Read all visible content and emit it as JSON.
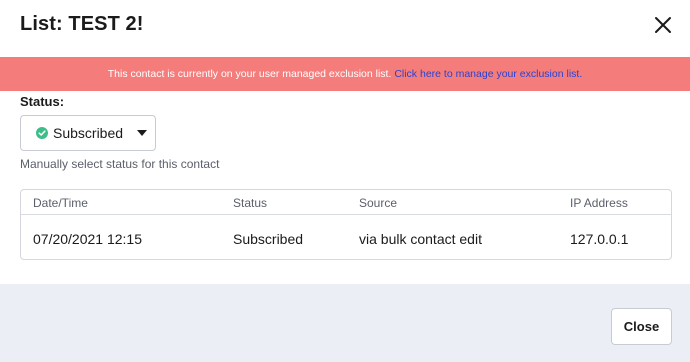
{
  "dialog": {
    "title": "List: TEST 2!"
  },
  "banner": {
    "message": "This contact is currently on your user managed exclusion list.",
    "link_text": "Click here to manage your exclusion list."
  },
  "status": {
    "label": "Status:",
    "selected": "Subscribed",
    "helper": "Manually select status for this contact"
  },
  "history": {
    "columns": [
      "Date/Time",
      "Status",
      "Source",
      "IP Address"
    ],
    "rows": [
      [
        "07/20/2021 12:15",
        "Subscribed",
        "via bulk contact edit",
        "127.0.0.1"
      ]
    ]
  },
  "footer": {
    "close_label": "Close"
  },
  "icons": {
    "close": "close-icon",
    "status_check": "check-circle-icon",
    "dropdown": "caret-down-icon"
  },
  "colors": {
    "banner_bg": "#f47d7c",
    "banner_link": "#2743d6",
    "subscribed_green": "#3dbd8a",
    "footer_bg": "#eceef5"
  }
}
